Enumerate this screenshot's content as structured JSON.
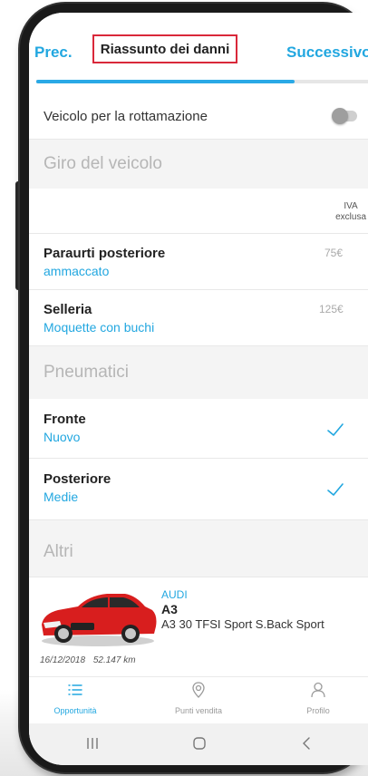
{
  "header": {
    "prev_label": "Prec.",
    "title": "Riassunto dei danni",
    "next_label": "Successivo",
    "progress": 0.78
  },
  "toggle_row": {
    "label": "Veicolo per la rottamazione",
    "enabled": false
  },
  "sections": {
    "vehicle_tour": "Giro del veicolo",
    "tires": "Pneumatici",
    "others": "Altri"
  },
  "vat_note": {
    "line1": "IVA",
    "line2": "exclusa"
  },
  "damages": [
    {
      "title": "Paraurti posteriore",
      "subtitle": "ammaccato",
      "price": "75€"
    },
    {
      "title": "Selleria",
      "subtitle": "Moquette con buchi",
      "price": "125€"
    }
  ],
  "tires": [
    {
      "title": "Fronte",
      "subtitle": "Nuovo",
      "checked": true
    },
    {
      "title": "Posteriore",
      "subtitle": "Medie",
      "checked": true
    }
  ],
  "car": {
    "brand": "AUDI",
    "model": "A3",
    "version": "A3 30 TFSI Sport S.Back Sport",
    "date": "16/12/2018",
    "mileage": "52.147 km",
    "color": "#d81e1e"
  },
  "nav": {
    "items": [
      {
        "label": "Opportunità",
        "icon": "list-icon",
        "active": true
      },
      {
        "label": "Punti vendita",
        "icon": "location-pin-icon",
        "active": false
      },
      {
        "label": "Profilo",
        "icon": "person-icon",
        "active": false
      }
    ]
  },
  "colors": {
    "accent": "#22a7e0",
    "highlight_border": "#d9283a"
  }
}
